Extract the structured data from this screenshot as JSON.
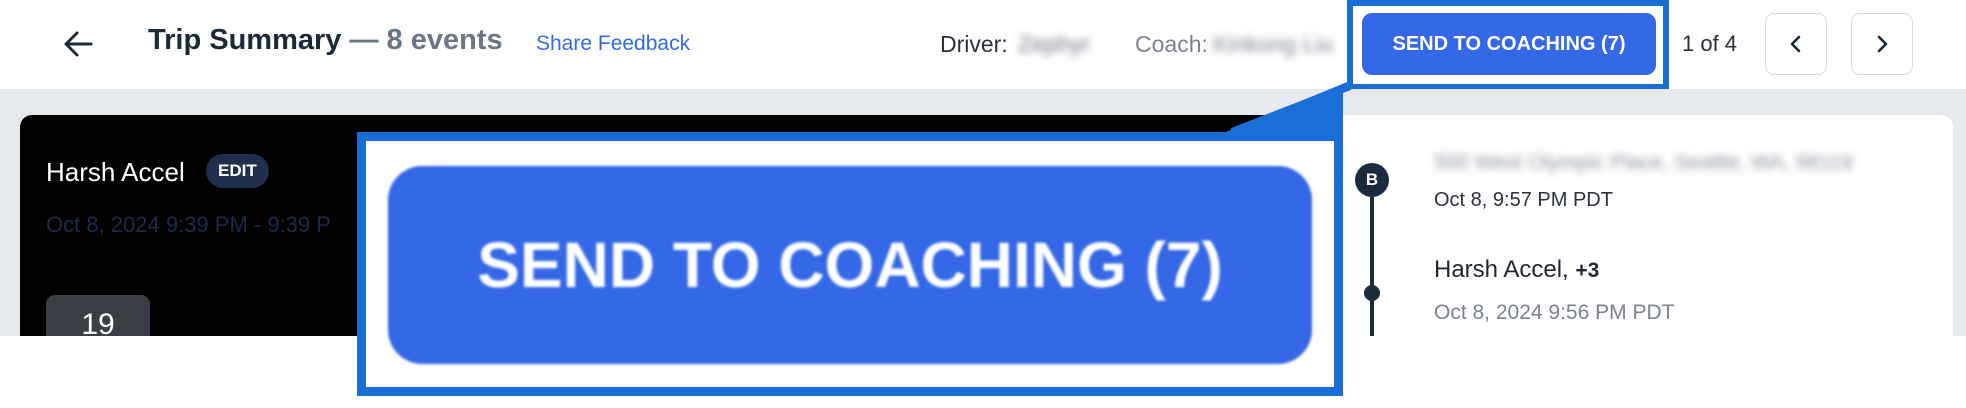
{
  "header": {
    "title": "Trip Summary",
    "event_count": "— 8 events",
    "share_link": "Share Feedback",
    "driver_label": "Driver:",
    "driver_value": "Zephyr",
    "coach_label": "Coach:",
    "coach_value": "Kinkong Liu",
    "send_button": "SEND TO COACHING (7)",
    "pager": "1 of 4",
    "icons": {
      "back": "arrow-left-icon",
      "prev": "chevron-left-icon",
      "next": "chevron-right-icon"
    }
  },
  "event_panel": {
    "event_name": "Harsh Accel",
    "edit_label": "EDIT",
    "time_range": "Oct 8, 2024 9:39 PM - 9:39 P",
    "speed": "19"
  },
  "timeline": {
    "pin_label": "B",
    "address": "500 West Olympic Place, Seattle, WA, 98119",
    "end_time": "Oct 8, 9:57 PM PDT",
    "event_name": "Harsh Accel,",
    "event_extra": "+3",
    "event_time": "Oct 8, 2024 9:56 PM PDT"
  },
  "zoom": {
    "label": "SEND TO COACHING (7)"
  },
  "colors": {
    "accent": "#3568e6",
    "highlight": "#1a6fd6",
    "dark": "#1b2a3c"
  }
}
